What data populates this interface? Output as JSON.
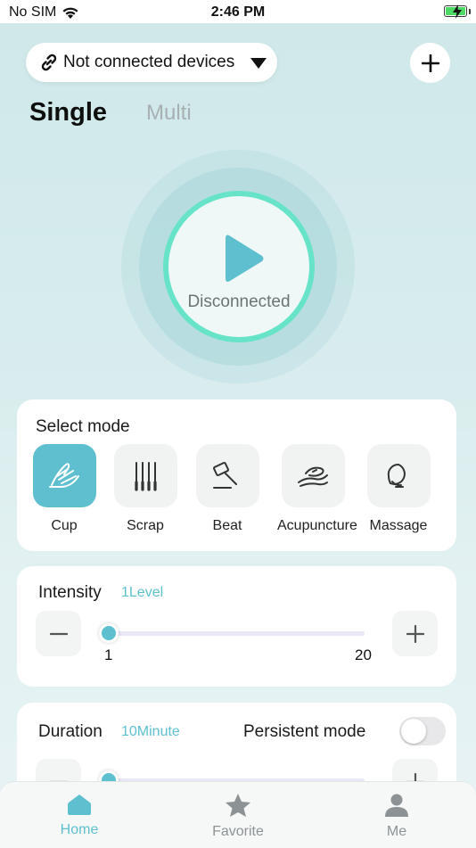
{
  "status_bar": {
    "carrier": "No SIM",
    "time": "2:46 PM"
  },
  "header": {
    "device_label": "Not connected devices"
  },
  "tabs": [
    {
      "label": "Single"
    },
    {
      "label": "Multi"
    }
  ],
  "player": {
    "status": "Disconnected"
  },
  "mode_card": {
    "title": "Select mode",
    "modes": [
      {
        "label": "Cup",
        "icon": "hand-icon",
        "active": true
      },
      {
        "label": "Scrap",
        "icon": "scrape-needles-icon"
      },
      {
        "label": "Beat",
        "icon": "hammer-icon"
      },
      {
        "label": "Acupuncture",
        "icon": "acupuncture-icon"
      },
      {
        "label": "Massage",
        "icon": "massage-icon"
      }
    ]
  },
  "intensity": {
    "label": "Intensity",
    "value_text": "1Level",
    "value": 1,
    "min": "1",
    "max": "20"
  },
  "duration": {
    "label": "Duration",
    "value_text": "10Minute",
    "persistent_label": "Persistent mode",
    "persistent_on": false
  },
  "tabbar": [
    {
      "label": "Home"
    },
    {
      "label": "Favorite"
    },
    {
      "label": "Me"
    }
  ],
  "colors": {
    "accent": "#5ec0cf",
    "ring": "#67e3c8",
    "active_tab": "#5ec0cf",
    "inactive_tab": "#8d9394"
  }
}
